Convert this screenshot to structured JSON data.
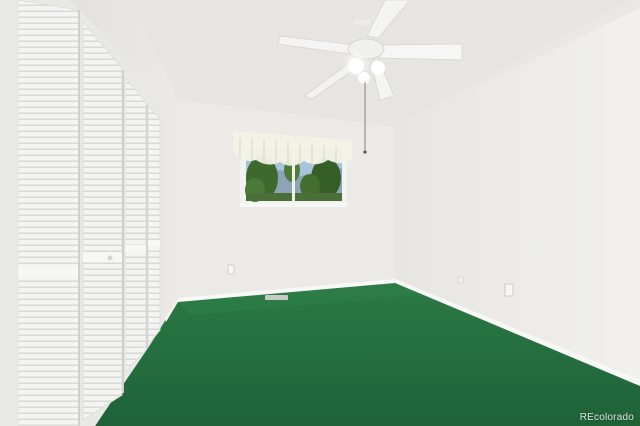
{
  "photo": {
    "watermark": "REcolorado",
    "colors": {
      "carpet": "#236b3e",
      "wall": "#ecebe7",
      "ceiling": "#e4e3df",
      "baseboard": "#f7f7f5",
      "closet_door": "#f3f3f1",
      "sky": "#a9c4da",
      "foliage": "#3f6b2e"
    }
  }
}
